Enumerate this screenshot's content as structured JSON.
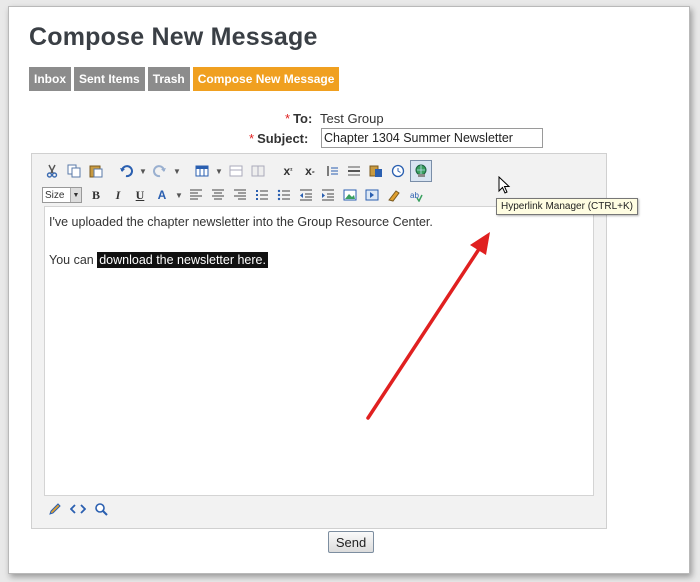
{
  "page": {
    "title": "Compose New Message"
  },
  "tabs": [
    {
      "label": "Inbox"
    },
    {
      "label": "Sent Items"
    },
    {
      "label": "Trash"
    },
    {
      "label": "Compose New Message",
      "active": true
    }
  ],
  "form": {
    "required_marker": "*",
    "to_label": "To:",
    "to_value": "Test Group",
    "subject_label": "Subject:",
    "subject_value": "Chapter 1304 Summer Newsletter"
  },
  "editor": {
    "font_size_label": "Size",
    "line1": "I've uploaded the chapter newsletter into the Group Resource Center.",
    "line2_prefix": "You can ",
    "line2_selected": "download the newsletter here.",
    "tooltip": "Hyperlink Manager (CTRL+K)"
  },
  "send_label": "Send",
  "colors": {
    "tab_active": "#f0a020",
    "tab_inactive": "#8c8c8c",
    "arrow": "#e02020",
    "required": "#e02020"
  }
}
